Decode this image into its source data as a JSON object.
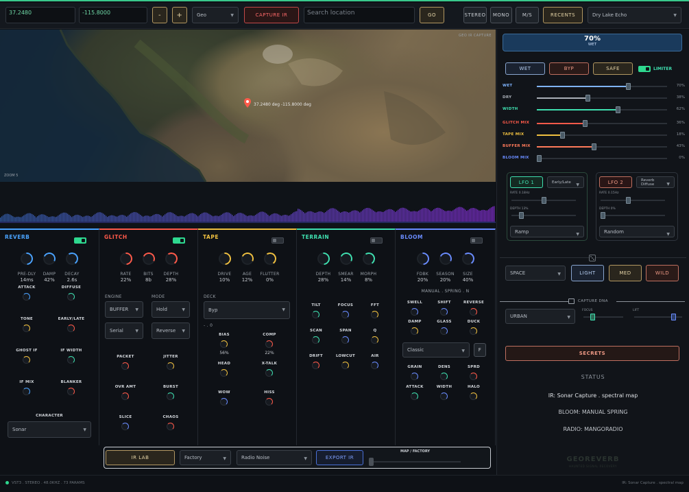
{
  "topbar": {
    "lat": "37.2480",
    "lon": "-115.8000",
    "minus": "-",
    "plus": "+",
    "source": "Geo",
    "capture_ir": "CAPTURE IR",
    "search_placeholder": "Search location",
    "go": "GO",
    "stereo": "STEREO",
    "mono": "MONO",
    "ms": "M/S",
    "recents": "RECENTS",
    "recent_value": "Dry Lake Echo"
  },
  "map": {
    "corner_label": "GEO IR CAPTURE",
    "pin_label": "37.2480 deg -115.8000 deg",
    "zoom": "ZOOM 5"
  },
  "modules": [
    {
      "title": "REVERB",
      "color": "#4aa3ff",
      "enabled": true,
      "knobs": [
        {
          "l": "PRE-DLY",
          "v": "14ms"
        },
        {
          "l": "DAMP",
          "v": "42%"
        },
        {
          "l": "DECAY",
          "v": "2.6s"
        }
      ],
      "small": [
        {
          "l": "ATTACK"
        },
        {
          "l": "DIFFUSE"
        },
        {
          "l": "TONE"
        },
        {
          "l": "EARLY/LATE"
        },
        {
          "l": "GHOST IF"
        },
        {
          "l": "IF WIDTH"
        },
        {
          "l": "IF MIX"
        },
        {
          "l": "BLANKER"
        }
      ],
      "character_label": "CHARACTER",
      "character_value": "Sonar"
    },
    {
      "title": "GLITCH",
      "color": "#ff5a4a",
      "enabled": true,
      "knobs": [
        {
          "l": "RATE",
          "v": "22%"
        },
        {
          "l": "BITS",
          "v": "8b"
        },
        {
          "l": "DEPTH",
          "v": "28%"
        }
      ],
      "engine_label": "ENGINE",
      "engine_value": "BUFFER",
      "mode_label": "MODE",
      "mode_value": "Hold",
      "chain_value": "Serial",
      "dir_value": "Reverse",
      "small": [
        {
          "l": "PACKET"
        },
        {
          "l": "JITTER"
        },
        {
          "l": "OVR AMT"
        },
        {
          "l": "BURST"
        },
        {
          "l": "SLICE"
        },
        {
          "l": "CHAOS"
        }
      ]
    },
    {
      "title": "TAPE",
      "color": "#f0c040",
      "enabled": false,
      "knobs": [
        {
          "l": "DRIVE",
          "v": "10%"
        },
        {
          "l": "AGE",
          "v": "12%"
        },
        {
          "l": "FLUTTER",
          "v": "0%"
        }
      ],
      "deck_label": "DECK",
      "deck_value": "Byp",
      "deck_note": "- . 0",
      "small": [
        {
          "l": "BIAS",
          "v": "56%"
        },
        {
          "l": "COMP",
          "v": "22%"
        },
        {
          "l": "HEAD"
        },
        {
          "l": "X-TALK"
        },
        {
          "l": "WOW"
        },
        {
          "l": "HISS"
        }
      ]
    },
    {
      "title": "TERRAIN",
      "color": "#3fe0b0",
      "enabled": false,
      "knobs": [
        {
          "l": "DEPTH",
          "v": "28%"
        },
        {
          "l": "SMEAR",
          "v": "14%"
        },
        {
          "l": "MORPH",
          "v": "8%"
        }
      ],
      "small": [
        {
          "l": "TILT"
        },
        {
          "l": "FOCUS"
        },
        {
          "l": "FFT"
        },
        {
          "l": "SCAN"
        },
        {
          "l": "SPAN"
        },
        {
          "l": "Q"
        },
        {
          "l": "DRIFT"
        },
        {
          "l": "LOWCUT"
        },
        {
          "l": "AIR"
        }
      ]
    },
    {
      "title": "BLOOM",
      "color": "#6a8cff",
      "enabled": false,
      "knobs": [
        {
          "l": "FDBK",
          "v": "20%"
        },
        {
          "l": "SEASON",
          "v": "20%"
        },
        {
          "l": "SIZE",
          "v": "40%"
        }
      ],
      "subtitle": "MANUAL . SPRING . N",
      "small": [
        {
          "l": "SWELL"
        },
        {
          "l": "SHIFT"
        },
        {
          "l": "REVERSE"
        },
        {
          "l": "DAMP"
        },
        {
          "l": "GLASS"
        },
        {
          "l": "DUCK"
        }
      ],
      "mode_value": "Classic",
      "mode_btn": "F",
      "small2": [
        {
          "l": "GRAIN"
        },
        {
          "l": "DENS"
        },
        {
          "l": "SPRD"
        },
        {
          "l": "ATTACK"
        },
        {
          "l": "WIDTH"
        },
        {
          "l": "HALO"
        }
      ]
    }
  ],
  "bottom": {
    "ir_lab": "IR LAB",
    "factory": "Factory",
    "radio": "Radio Noise",
    "export": "EXPORT IR",
    "map_factory": "MAP / FACTORY"
  },
  "status_bar": {
    "left": "VST3 . STEREO . 48.0KHZ . 73 PARAMS",
    "right": "IR: Sonar Capture . spectral map"
  },
  "right": {
    "meter_value": "70%",
    "meter_label": "WET",
    "wet_btn": "WET",
    "byp_btn": "BYP",
    "safe_btn": "SAFE",
    "limiter": "LIMITER",
    "sliders": [
      {
        "n": "WET",
        "v": "70%",
        "f": 0.7,
        "c": "#7fb4ff"
      },
      {
        "n": "DRY",
        "v": "38%",
        "f": 0.38,
        "c": "#aab0b8"
      },
      {
        "n": "WIDTH",
        "v": "62%",
        "f": 0.62,
        "c": "#3fe0b0"
      },
      {
        "n": "GLITCH MIX",
        "v": "36%",
        "f": 0.36,
        "c": "#ff5a4a"
      },
      {
        "n": "TAPE MIX",
        "v": "18%",
        "f": 0.18,
        "c": "#f0c040"
      },
      {
        "n": "BUFFER MIX",
        "v": "43%",
        "f": 0.43,
        "c": "#ff7a5a"
      },
      {
        "n": "BLOOM MIX",
        "v": "0%",
        "f": 0.0,
        "c": "#6a8cff"
      }
    ],
    "lfo1": {
      "title": "LFO 1",
      "target": "Early/Late",
      "rate": "RATE 0.18Hz",
      "depth": "DEPTH 13%",
      "shape": "Ramp",
      "rate_f": 0.5,
      "depth_f": 0.13
    },
    "lfo2": {
      "title": "LFO 2",
      "target": "Reverb Diffuse",
      "rate": "RATE 0.15Hz",
      "depth": "DEPTH 0%",
      "shape": "Random",
      "rate_f": 0.42,
      "depth_f": 0.0
    },
    "space": "SPACE",
    "light": "LIGHT",
    "med": "MED",
    "wild": "WILD",
    "capture_dna": "CAPTURE DNA",
    "urban": "URBAN",
    "focus": "FOCUS",
    "lift": "LIFT",
    "focus_f": 0.2,
    "lift_f": 0.85,
    "secrets": "SECRETS",
    "status_title": "STATUS",
    "status_lines": [
      "IR: Sonar Capture . spectral map",
      "BLOOM: MANUAL SPRING",
      "RADIO: MANGORADIO"
    ],
    "logo": "GEOREVERB",
    "logo_sub": "HAUNTED SIGNAL RECOVERY"
  }
}
